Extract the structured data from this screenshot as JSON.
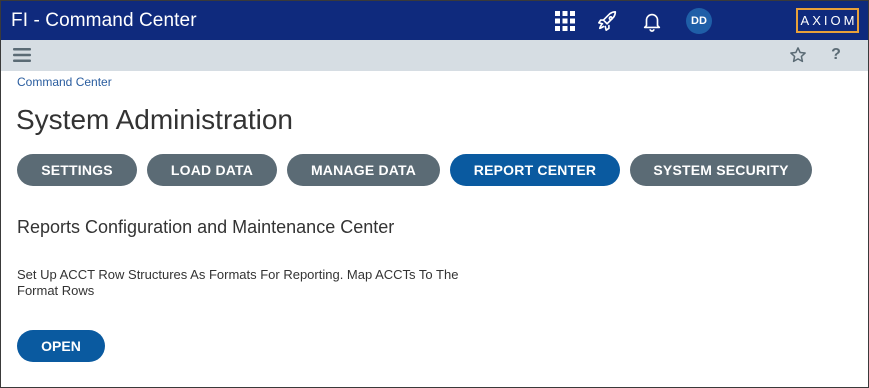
{
  "header": {
    "title": "FI - Command Center",
    "icons": [
      "apps-grid-icon",
      "rocket-icon",
      "bell-icon"
    ],
    "avatar_initials": "DD",
    "logo_text": "AXIOM",
    "colors": {
      "bar": "#0f2a7d",
      "logo_border": "#e8a13a",
      "avatar": "#1f5fa8"
    }
  },
  "subbar": {
    "icons": [
      "hamburger-menu-icon",
      "star-icon",
      "help-icon"
    ],
    "help_label": "?"
  },
  "breadcrumb": "Command Center",
  "page_title": "System Administration",
  "tabs": [
    {
      "label": "SETTINGS",
      "active": false
    },
    {
      "label": "LOAD DATA",
      "active": false
    },
    {
      "label": "MANAGE DATA",
      "active": false
    },
    {
      "label": "REPORT CENTER",
      "active": true
    },
    {
      "label": "SYSTEM SECURITY",
      "active": false
    }
  ],
  "section": {
    "heading": "Reports Configuration and Maintenance Center",
    "description": "Set Up ACCT Row Structures As Formats For Reporting. Map ACCTs To The Format Rows",
    "open_label": "OPEN"
  },
  "colors": {
    "tab_inactive": "#5b6b75",
    "tab_active": "#0a5aa0",
    "subbar": "#d6dde3"
  }
}
